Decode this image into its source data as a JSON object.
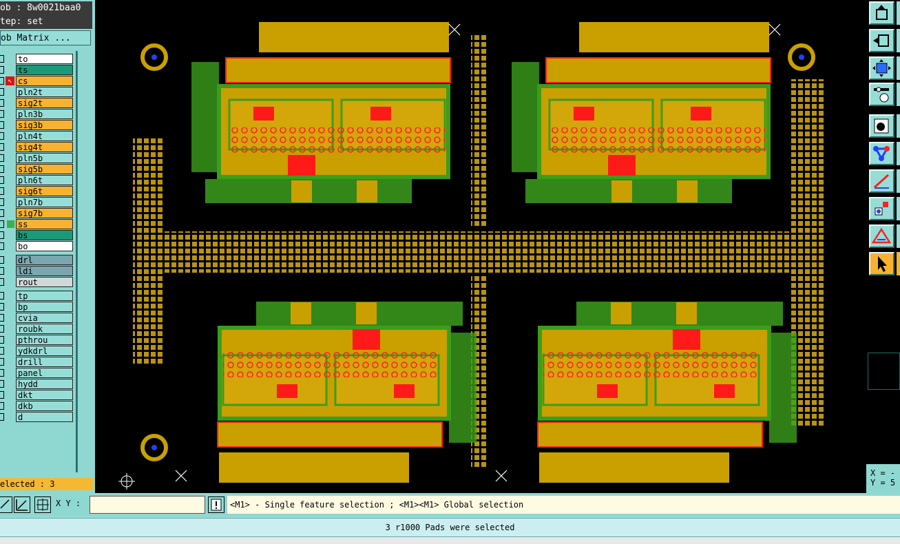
{
  "header": {
    "job": "ob : 8w0021baa0",
    "step": "tep: set"
  },
  "matrix_button": "ob Matrix ...",
  "layers": [
    {
      "name": "to",
      "color": "#ffffff",
      "icon": "",
      "text": "#000000"
    },
    {
      "name": "ts",
      "color": "#1a9a78",
      "icon": "",
      "text": "#000000"
    },
    {
      "name": "cs",
      "color": "#f6b230",
      "icon": "cursor-icon",
      "text": "#000000"
    },
    {
      "name": "pln2t",
      "color": "#97ddd7",
      "icon": "",
      "text": "#000000"
    },
    {
      "name": "sig2t",
      "color": "#f6b230",
      "icon": "",
      "text": "#000000"
    },
    {
      "name": "pln3b",
      "color": "#97ddd7",
      "icon": "",
      "text": "#000000"
    },
    {
      "name": "sig3b",
      "color": "#f6b230",
      "icon": "",
      "text": "#000000"
    },
    {
      "name": "pln4t",
      "color": "#97ddd7",
      "icon": "",
      "text": "#000000"
    },
    {
      "name": "sig4t",
      "color": "#f6b230",
      "icon": "",
      "text": "#000000"
    },
    {
      "name": "pln5b",
      "color": "#97ddd7",
      "icon": "",
      "text": "#000000"
    },
    {
      "name": "sig5b",
      "color": "#f6b230",
      "icon": "",
      "text": "#000000"
    },
    {
      "name": "pln6t",
      "color": "#97ddd7",
      "icon": "",
      "text": "#000000"
    },
    {
      "name": "sig6t",
      "color": "#f6b230",
      "icon": "",
      "text": "#000000"
    },
    {
      "name": "pln7b",
      "color": "#97ddd7",
      "icon": "",
      "text": "#000000"
    },
    {
      "name": "sig7b",
      "color": "#f6b230",
      "icon": "",
      "text": "#000000"
    },
    {
      "name": "ss",
      "color": "#f6b230",
      "icon": "",
      "text": "#000000"
    },
    {
      "name": "bs",
      "color": "#1a9a78",
      "icon": "",
      "text": "#000000"
    },
    {
      "name": "bo",
      "color": "#ffffff",
      "icon": "",
      "text": "#000000"
    },
    {
      "name": "drl",
      "color": "#7aa6b0",
      "icon": "",
      "text": "#000000"
    },
    {
      "name": "ldi",
      "color": "#7aa6b0",
      "icon": "",
      "text": "#000000"
    },
    {
      "name": "rout",
      "color": "#cfd7d8",
      "icon": "",
      "text": "#000000"
    },
    {
      "name": "tp",
      "color": "#97ddd7",
      "icon": "",
      "text": "#000000"
    },
    {
      "name": "bp",
      "color": "#97ddd7",
      "icon": "",
      "text": "#000000"
    },
    {
      "name": "cvia",
      "color": "#97ddd7",
      "icon": "",
      "text": "#000000"
    },
    {
      "name": "roubk",
      "color": "#97ddd7",
      "icon": "",
      "text": "#000000"
    },
    {
      "name": "pthrou",
      "color": "#97ddd7",
      "icon": "",
      "text": "#000000"
    },
    {
      "name": "ydkdrl",
      "color": "#97ddd7",
      "icon": "",
      "text": "#000000"
    },
    {
      "name": "drill",
      "color": "#97ddd7",
      "icon": "",
      "text": "#000000"
    },
    {
      "name": "panel",
      "color": "#97ddd7",
      "icon": "",
      "text": "#000000"
    },
    {
      "name": "hydd",
      "color": "#97ddd7",
      "icon": "",
      "text": "#000000"
    },
    {
      "name": "dkt",
      "color": "#97ddd7",
      "icon": "",
      "text": "#000000"
    },
    {
      "name": "dkb",
      "color": "#97ddd7",
      "icon": "",
      "text": "#000000"
    },
    {
      "name": "d",
      "color": "#97ddd7",
      "icon": "",
      "text": "#000000"
    }
  ],
  "selected_count": "elected : 3",
  "toolbar_icons": [
    "export-icon",
    "import-icon",
    "zoom-fit-icon",
    "settings-icon",
    "snap-icon",
    "net-icon",
    "measure-icon",
    "feature-icon",
    "drc-icon",
    "select-pointer-icon"
  ],
  "coordinates": {
    "x": "X = -",
    "y": "Y = 5"
  },
  "xy_label": "X Y :",
  "xy_value": "",
  "hint_text": "<M1> - Single feature selection ; <M1><M1> Global selection",
  "status_text": "3 r1000 Pads were selected",
  "colors": {
    "copper": "#c9a000",
    "pad": "#b89412",
    "mask": "#ff1a1a",
    "silk": "#3c9d1c"
  }
}
